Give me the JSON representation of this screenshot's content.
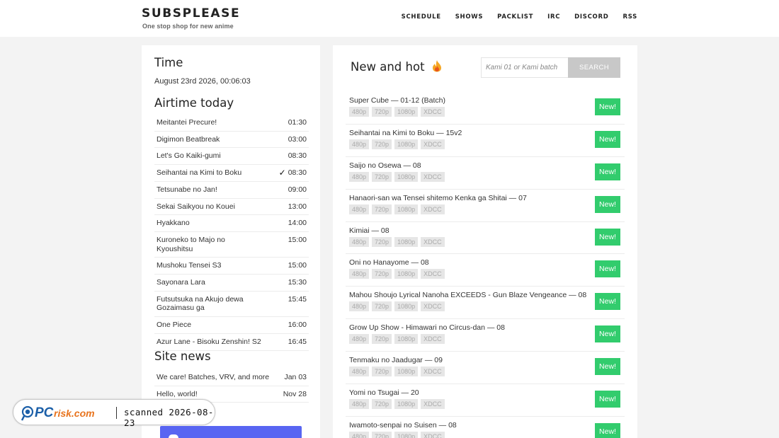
{
  "header": {
    "title": "SUBSPLEASE",
    "tagline": "One stop shop for new anime",
    "nav": [
      "SCHEDULE",
      "SHOWS",
      "PACKLIST",
      "IRC",
      "DISCORD",
      "RSS"
    ]
  },
  "time": {
    "heading": "Time",
    "value": "August 23rd 2026, 00:06:03"
  },
  "airtime": {
    "heading": "Airtime today",
    "items": [
      {
        "name": "Meitantei Precure!",
        "time": "01:30",
        "aired": false
      },
      {
        "name": "Digimon Beatbreak",
        "time": "03:00",
        "aired": false
      },
      {
        "name": "Let's Go Kaiki-gumi",
        "time": "08:30",
        "aired": false
      },
      {
        "name": "Seihantai na Kimi to Boku",
        "time": "08:30",
        "aired": true
      },
      {
        "name": "Tetsunabe no Jan!",
        "time": "09:00",
        "aired": false
      },
      {
        "name": "Sekai Saikyou no Kouei",
        "time": "13:00",
        "aired": false
      },
      {
        "name": "Hyakkano",
        "time": "14:00",
        "aired": false
      },
      {
        "name": "Kuroneko to Majo no Kyoushitsu",
        "time": "15:00",
        "aired": false
      },
      {
        "name": "Mushoku Tensei S3",
        "time": "15:00",
        "aired": false
      },
      {
        "name": "Sayonara Lara",
        "time": "15:30",
        "aired": false
      },
      {
        "name": "Futsutsuka na Akujo dewa Gozaimasu ga",
        "time": "15:45",
        "aired": false
      },
      {
        "name": "One Piece",
        "time": "16:00",
        "aired": false
      },
      {
        "name": "Azur Lane - Bisoku Zenshin! S2",
        "time": "16:45",
        "aired": false
      }
    ]
  },
  "news": {
    "heading": "Site news",
    "items": [
      {
        "title": "We care! Batches, VRV, and more",
        "date": "Jan 03"
      },
      {
        "title": "Hello, world!",
        "date": "Nov 28"
      }
    ]
  },
  "newhot": {
    "heading": "New and hot",
    "icon": "fire-icon",
    "search_placeholder": "Kami 01 or Kami batch",
    "search_label": "SEARCH",
    "badge_label": "New!",
    "qualities": [
      "480p",
      "720p",
      "1080p",
      "XDCC"
    ],
    "releases": [
      "Super Cube — 01-12 (Batch)",
      "Seihantai na Kimi to Boku — 15v2",
      "Saijo no Osewa — 08",
      "Hanaori-san wa Tensei shitemo Kenka ga Shitai — 07",
      "Kimiai — 08",
      "Oni no Hanayome — 08",
      "Mahou Shoujo Lyrical Nanoha EXCEEDS - Gun Blaze Vengeance — 08",
      "Grow Up Show - Himawari no Circus-dan — 08",
      "Tenmaku no Jaadugar — 09",
      "Yomi no Tsugai — 20",
      "Iwamoto-senpai no Suisen — 08"
    ]
  },
  "watermark": {
    "logo_pc": "PC",
    "logo_rest": "risk.com",
    "text": "scanned 2026-08-23"
  },
  "colors": {
    "new_badge": "#32cc6d",
    "discord": "#5865f2",
    "search_button": "#c8c8c8"
  }
}
